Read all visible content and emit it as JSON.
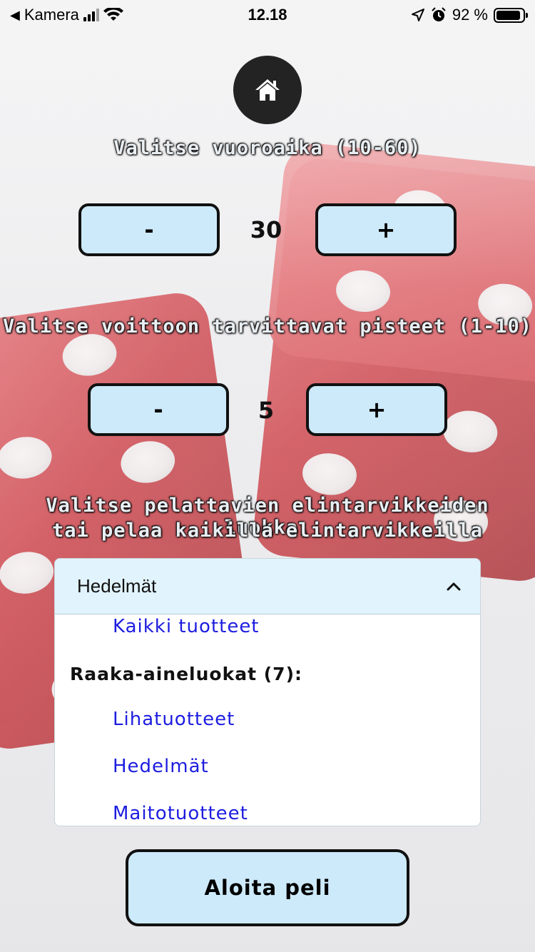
{
  "status_bar": {
    "back_app": "Kamera",
    "time": "12.18",
    "battery_percent": "92 %",
    "battery_level": 0.92
  },
  "turn_time": {
    "heading": "Valitse vuoroaika (10-60)",
    "minus_label": "-",
    "value": "30",
    "plus_label": "+"
  },
  "win_points": {
    "heading": "Valitse voittoon tarvittavat pisteet (1-10)",
    "minus_label": "-",
    "value": "5",
    "plus_label": "+"
  },
  "category": {
    "heading_line1": "Valitse pelattavien elintarvikkeiden luokka,",
    "heading_line2": "tai pelaa kaikilla elintarvikkeilla",
    "selected": "Hedelmät",
    "options": {
      "all": "Kaikki tuotteet",
      "group_label": "Raaka-aineluokat (7):",
      "meat": "Lihatuotteet",
      "fruit": "Hedelmät",
      "dairy": "Maitotuotteet"
    }
  },
  "start_button": "Aloita peli",
  "icons": {
    "home": "home-icon",
    "chevron": "chevron-up-icon"
  }
}
